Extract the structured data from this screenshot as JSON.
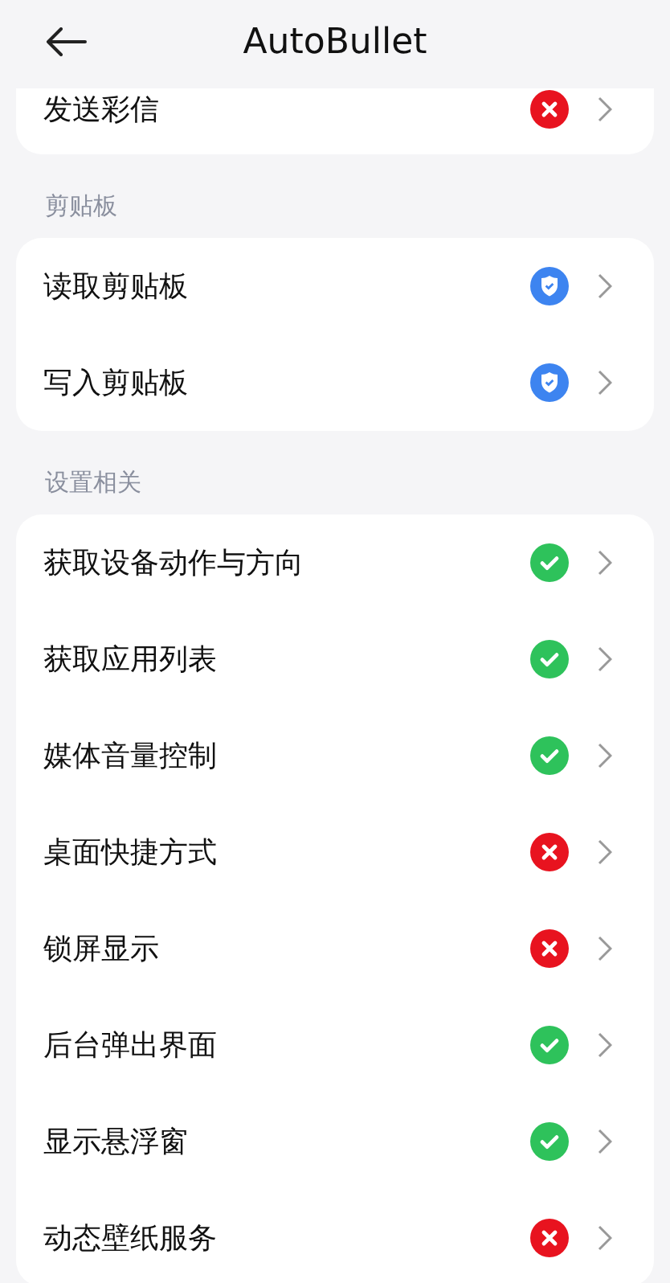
{
  "header": {
    "title": "AutoBullet"
  },
  "sections": [
    {
      "items": [
        {
          "label": "发送彩信",
          "kind": "denied"
        }
      ]
    },
    {
      "title": "剪贴板",
      "items": [
        {
          "label": "读取剪贴板",
          "kind": "ask"
        },
        {
          "label": "写入剪贴板",
          "kind": "ask"
        }
      ]
    },
    {
      "title": "设置相关",
      "items": [
        {
          "label": "获取设备动作与方向",
          "kind": "allowed"
        },
        {
          "label": "获取应用列表",
          "kind": "allowed"
        },
        {
          "label": "媒体音量控制",
          "kind": "allowed"
        },
        {
          "label": "桌面快捷方式",
          "kind": "denied"
        },
        {
          "label": "锁屏显示",
          "kind": "denied"
        },
        {
          "label": "后台弹出界面",
          "kind": "allowed"
        },
        {
          "label": "显示悬浮窗",
          "kind": "allowed"
        },
        {
          "label": "动态壁纸服务",
          "kind": "denied"
        }
      ]
    }
  ]
}
